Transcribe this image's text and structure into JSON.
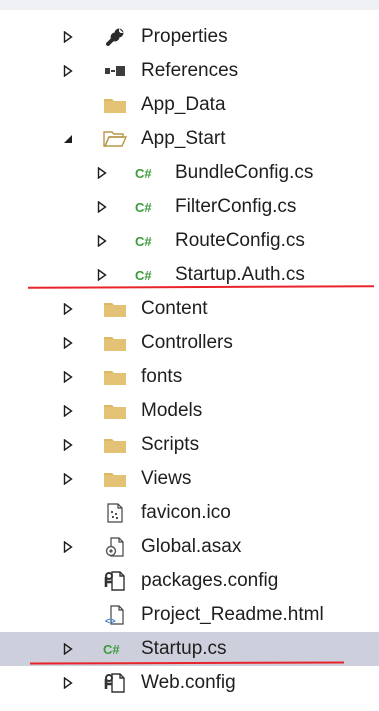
{
  "colors": {
    "folder": "#dcb862",
    "csharp": "#3d9b3d",
    "selection": "#cdd0dc",
    "annotation": "#e8242a"
  },
  "tree": {
    "properties": {
      "label": "Properties",
      "icon": "wrench-icon"
    },
    "references": {
      "label": "References",
      "icon": "references-icon"
    },
    "app_data": {
      "label": "App_Data",
      "icon": "folder-icon"
    },
    "app_start": {
      "label": "App_Start",
      "icon": "folder-open-icon",
      "expanded": true
    },
    "bundleconfig": {
      "label": "BundleConfig.cs",
      "icon": "csharp-file-icon"
    },
    "filterconfig": {
      "label": "FilterConfig.cs",
      "icon": "csharp-file-icon"
    },
    "routeconfig": {
      "label": "RouteConfig.cs",
      "icon": "csharp-file-icon"
    },
    "startup_auth": {
      "label": "Startup.Auth.cs",
      "icon": "csharp-file-icon"
    },
    "content": {
      "label": "Content",
      "icon": "folder-icon"
    },
    "controllers": {
      "label": "Controllers",
      "icon": "folder-icon"
    },
    "fonts": {
      "label": "fonts",
      "icon": "folder-icon"
    },
    "models": {
      "label": "Models",
      "icon": "folder-icon"
    },
    "scripts": {
      "label": "Scripts",
      "icon": "folder-icon"
    },
    "views": {
      "label": "Views",
      "icon": "folder-icon"
    },
    "favicon": {
      "label": "favicon.ico",
      "icon": "image-file-icon"
    },
    "global_asax": {
      "label": "Global.asax",
      "icon": "global-asax-icon"
    },
    "packages_config": {
      "label": "packages.config",
      "icon": "config-file-icon"
    },
    "project_readme": {
      "label": "Project_Readme.html",
      "icon": "html-file-icon"
    },
    "startup_cs": {
      "label": "Startup.cs",
      "icon": "csharp-file-icon",
      "selected": true
    },
    "web_config": {
      "label": "Web.config",
      "icon": "config-file-icon"
    }
  },
  "csharp_glyph": "C#"
}
